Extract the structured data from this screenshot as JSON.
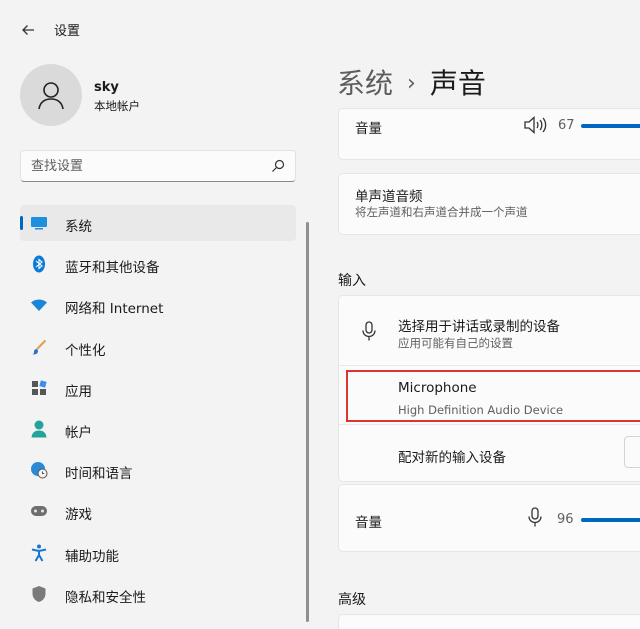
{
  "app": {
    "title": "设置"
  },
  "account": {
    "name": "sky",
    "type": "本地帐户"
  },
  "search": {
    "placeholder": "查找设置"
  },
  "sidebar": {
    "items": [
      {
        "label": "系统",
        "icon": "monitor-icon",
        "active": true
      },
      {
        "label": "蓝牙和其他设备",
        "icon": "bluetooth-icon"
      },
      {
        "label": "网络和 Internet",
        "icon": "wifi-icon"
      },
      {
        "label": "个性化",
        "icon": "brush-icon"
      },
      {
        "label": "应用",
        "icon": "apps-icon"
      },
      {
        "label": "帐户",
        "icon": "person-icon"
      },
      {
        "label": "时间和语言",
        "icon": "globe-clock-icon"
      },
      {
        "label": "游戏",
        "icon": "gamepad-icon"
      },
      {
        "label": "辅助功能",
        "icon": "accessibility-icon"
      },
      {
        "label": "隐私和安全性",
        "icon": "shield-icon"
      }
    ]
  },
  "breadcrumb": {
    "parent": "系统",
    "separator": "›",
    "current": "声音"
  },
  "output": {
    "volume_label": "音量",
    "volume_value": "67",
    "mono_title": "单声道音频",
    "mono_desc": "将左声道和右声道合并成一个声道"
  },
  "input": {
    "heading": "输入",
    "choose_title": "选择用于讲话或录制的设备",
    "choose_desc": "应用可能有自己的设置",
    "device_name": "Microphone",
    "device_desc": "High Definition Audio Device",
    "pair_label": "配对新的输入设备",
    "volume_label": "音量",
    "volume_value": "96"
  },
  "advanced": {
    "heading": "高级"
  },
  "colors": {
    "accent": "#0067c0",
    "highlight": "#d9362f"
  }
}
